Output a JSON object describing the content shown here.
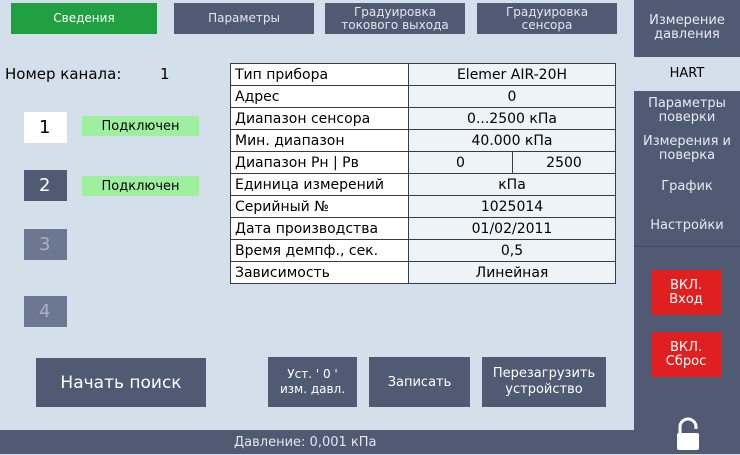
{
  "tabs": [
    {
      "label": "Сведения"
    },
    {
      "label": "Параметры"
    },
    {
      "label": "Градуировка\nтокового выхода"
    },
    {
      "label": "Градуировка\nсенсора"
    }
  ],
  "sidebar": {
    "items": [
      {
        "label": "Измерение\nдавления"
      },
      {
        "label": "HART"
      },
      {
        "label": "Параметры\nповерки"
      },
      {
        "label": "Измерения и\nповерка"
      },
      {
        "label": "График"
      },
      {
        "label": "Настройки"
      }
    ],
    "input_on": "ВКЛ.\nВход",
    "reset_on": "ВКЛ.\nСброс"
  },
  "channel": {
    "label": "Номер канала:",
    "number": "1"
  },
  "channels": [
    {
      "num": "1",
      "status": "Подключен"
    },
    {
      "num": "2",
      "status": "Подключен"
    },
    {
      "num": "3"
    },
    {
      "num": "4"
    }
  ],
  "device": {
    "rows": [
      {
        "label": "Тип прибора",
        "value": "Elemer AIR-20H"
      },
      {
        "label": "Адрес",
        "value": "0"
      },
      {
        "label": "Диапазон сенсора",
        "value": "0...2500 кПа"
      },
      {
        "label": "Мин. диапазон",
        "value": "40.000 кПа"
      },
      {
        "label": "Диапазон Рн | Рв",
        "low": "0",
        "high": "2500"
      },
      {
        "label": "Единица измерений",
        "value": "кПа"
      },
      {
        "label": "Серийный №",
        "value": "1025014"
      },
      {
        "label": "Дата производства",
        "value": "01/02/2011"
      },
      {
        "label": "Время демпф., сек.",
        "value": "0,5"
      },
      {
        "label": "Зависимость",
        "value": "Линейная"
      }
    ]
  },
  "buttons": {
    "search": "Начать поиск",
    "set_zero": "Уст. ' 0 '\nизм. давл.",
    "write": "Записать",
    "reboot": "Перезагрузить\nустройство"
  },
  "status": {
    "pressure": "Давление: 0,001 кПа"
  }
}
